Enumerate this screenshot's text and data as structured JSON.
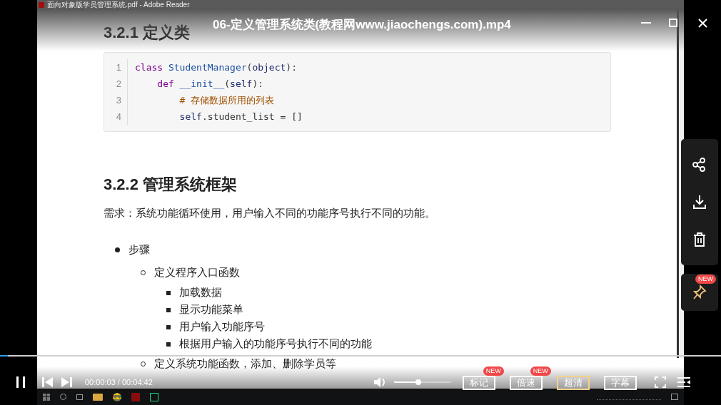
{
  "video": {
    "title": "06-定义管理系统类(教程网www.jiaochengs.com).mp4",
    "progress": {
      "level": 0.011
    }
  },
  "recording": {
    "reader_title": "面向对象版学员管理系统.pdf - Adobe Reader",
    "heading_1": "3.2.1 定义类",
    "code_lines": [
      {
        "number": "1",
        "tokens": [
          {
            "kind": "keyword",
            "text": "class"
          },
          {
            "kind": "name",
            "text": " StudentManager"
          },
          {
            "kind": "plain",
            "text": "("
          },
          {
            "kind": "builtin",
            "text": "object"
          },
          {
            "kind": "plain",
            "text": "):"
          }
        ]
      },
      {
        "number": "2",
        "tokens": [
          {
            "kind": "keyword",
            "text": "    def"
          },
          {
            "kind": "name",
            "text": " __init__"
          },
          {
            "kind": "plain",
            "text": "("
          },
          {
            "kind": "builtin",
            "text": "self"
          },
          {
            "kind": "plain",
            "text": "):"
          }
        ]
      },
      {
        "number": "3",
        "tokens": [
          {
            "kind": "comment",
            "text": "        # 存储数据所用的列表"
          }
        ]
      },
      {
        "number": "4",
        "tokens": [
          {
            "kind": "builtin",
            "text": "        self"
          },
          {
            "kind": "plain",
            "text": ".student_list = []"
          }
        ]
      }
    ],
    "heading_2": "3.2.2 管理系统框架",
    "requirement": "需求：系统功能循环使用，用户输入不同的功能序号执行不同的功能。",
    "list": [
      {
        "text": "步骤",
        "children": [
          {
            "text": "定义程序入口函数",
            "children": [
              {
                "text": "加载数据"
              },
              {
                "text": "显示功能菜单"
              },
              {
                "text": "用户输入功能序号"
              },
              {
                "text": "根据用户输入的功能序号执行不同的功能"
              }
            ]
          },
          {
            "text": "定义系统功能函数，添加、删除学员等"
          }
        ]
      }
    ]
  },
  "controls": {
    "time": "00:00:03 / 00:04:42",
    "volume": {
      "level": 0.43
    },
    "buttons": [
      {
        "label": "标记",
        "badge": "NEW",
        "selected": false
      },
      {
        "label": "倍速",
        "badge": "NEW",
        "selected": false
      },
      {
        "label": "超清",
        "selected": true
      },
      {
        "label": "字幕",
        "selected": false
      }
    ]
  },
  "side_panel": {
    "badge": "NEW"
  }
}
